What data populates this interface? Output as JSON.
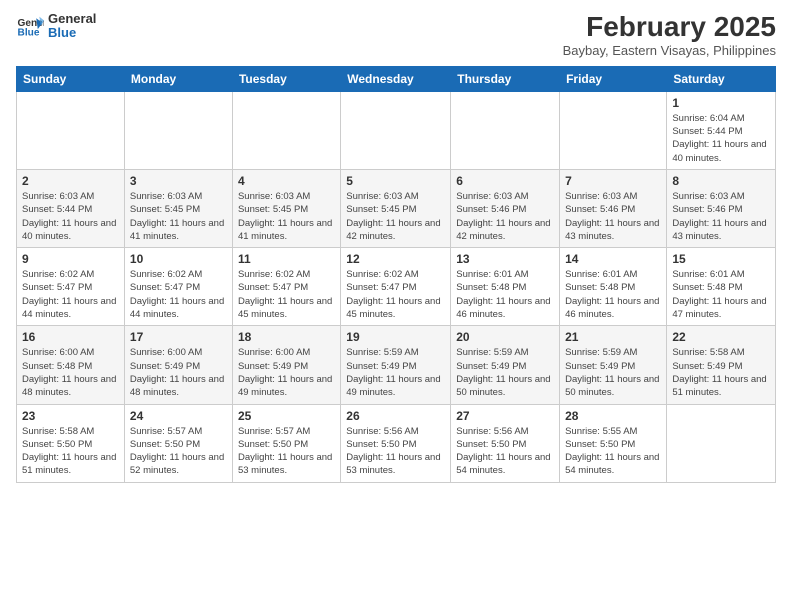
{
  "header": {
    "logo_line1": "General",
    "logo_line2": "Blue",
    "month_title": "February 2025",
    "subtitle": "Baybay, Eastern Visayas, Philippines"
  },
  "weekdays": [
    "Sunday",
    "Monday",
    "Tuesday",
    "Wednesday",
    "Thursday",
    "Friday",
    "Saturday"
  ],
  "weeks": [
    [
      {
        "day": "",
        "info": ""
      },
      {
        "day": "",
        "info": ""
      },
      {
        "day": "",
        "info": ""
      },
      {
        "day": "",
        "info": ""
      },
      {
        "day": "",
        "info": ""
      },
      {
        "day": "",
        "info": ""
      },
      {
        "day": "1",
        "info": "Sunrise: 6:04 AM\nSunset: 5:44 PM\nDaylight: 11 hours\nand 40 minutes."
      }
    ],
    [
      {
        "day": "2",
        "info": "Sunrise: 6:03 AM\nSunset: 5:44 PM\nDaylight: 11 hours\nand 40 minutes."
      },
      {
        "day": "3",
        "info": "Sunrise: 6:03 AM\nSunset: 5:45 PM\nDaylight: 11 hours\nand 41 minutes."
      },
      {
        "day": "4",
        "info": "Sunrise: 6:03 AM\nSunset: 5:45 PM\nDaylight: 11 hours\nand 41 minutes."
      },
      {
        "day": "5",
        "info": "Sunrise: 6:03 AM\nSunset: 5:45 PM\nDaylight: 11 hours\nand 42 minutes."
      },
      {
        "day": "6",
        "info": "Sunrise: 6:03 AM\nSunset: 5:46 PM\nDaylight: 11 hours\nand 42 minutes."
      },
      {
        "day": "7",
        "info": "Sunrise: 6:03 AM\nSunset: 5:46 PM\nDaylight: 11 hours\nand 43 minutes."
      },
      {
        "day": "8",
        "info": "Sunrise: 6:03 AM\nSunset: 5:46 PM\nDaylight: 11 hours\nand 43 minutes."
      }
    ],
    [
      {
        "day": "9",
        "info": "Sunrise: 6:02 AM\nSunset: 5:47 PM\nDaylight: 11 hours\nand 44 minutes."
      },
      {
        "day": "10",
        "info": "Sunrise: 6:02 AM\nSunset: 5:47 PM\nDaylight: 11 hours\nand 44 minutes."
      },
      {
        "day": "11",
        "info": "Sunrise: 6:02 AM\nSunset: 5:47 PM\nDaylight: 11 hours\nand 45 minutes."
      },
      {
        "day": "12",
        "info": "Sunrise: 6:02 AM\nSunset: 5:47 PM\nDaylight: 11 hours\nand 45 minutes."
      },
      {
        "day": "13",
        "info": "Sunrise: 6:01 AM\nSunset: 5:48 PM\nDaylight: 11 hours\nand 46 minutes."
      },
      {
        "day": "14",
        "info": "Sunrise: 6:01 AM\nSunset: 5:48 PM\nDaylight: 11 hours\nand 46 minutes."
      },
      {
        "day": "15",
        "info": "Sunrise: 6:01 AM\nSunset: 5:48 PM\nDaylight: 11 hours\nand 47 minutes."
      }
    ],
    [
      {
        "day": "16",
        "info": "Sunrise: 6:00 AM\nSunset: 5:48 PM\nDaylight: 11 hours\nand 48 minutes."
      },
      {
        "day": "17",
        "info": "Sunrise: 6:00 AM\nSunset: 5:49 PM\nDaylight: 11 hours\nand 48 minutes."
      },
      {
        "day": "18",
        "info": "Sunrise: 6:00 AM\nSunset: 5:49 PM\nDaylight: 11 hours\nand 49 minutes."
      },
      {
        "day": "19",
        "info": "Sunrise: 5:59 AM\nSunset: 5:49 PM\nDaylight: 11 hours\nand 49 minutes."
      },
      {
        "day": "20",
        "info": "Sunrise: 5:59 AM\nSunset: 5:49 PM\nDaylight: 11 hours\nand 50 minutes."
      },
      {
        "day": "21",
        "info": "Sunrise: 5:59 AM\nSunset: 5:49 PM\nDaylight: 11 hours\nand 50 minutes."
      },
      {
        "day": "22",
        "info": "Sunrise: 5:58 AM\nSunset: 5:49 PM\nDaylight: 11 hours\nand 51 minutes."
      }
    ],
    [
      {
        "day": "23",
        "info": "Sunrise: 5:58 AM\nSunset: 5:50 PM\nDaylight: 11 hours\nand 51 minutes."
      },
      {
        "day": "24",
        "info": "Sunrise: 5:57 AM\nSunset: 5:50 PM\nDaylight: 11 hours\nand 52 minutes."
      },
      {
        "day": "25",
        "info": "Sunrise: 5:57 AM\nSunset: 5:50 PM\nDaylight: 11 hours\nand 53 minutes."
      },
      {
        "day": "26",
        "info": "Sunrise: 5:56 AM\nSunset: 5:50 PM\nDaylight: 11 hours\nand 53 minutes."
      },
      {
        "day": "27",
        "info": "Sunrise: 5:56 AM\nSunset: 5:50 PM\nDaylight: 11 hours\nand 54 minutes."
      },
      {
        "day": "28",
        "info": "Sunrise: 5:55 AM\nSunset: 5:50 PM\nDaylight: 11 hours\nand 54 minutes."
      },
      {
        "day": "",
        "info": ""
      }
    ]
  ]
}
